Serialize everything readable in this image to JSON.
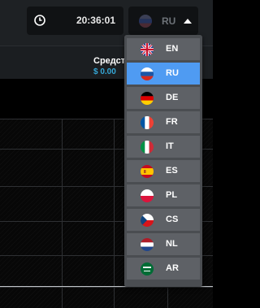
{
  "header": {
    "time": "20:36:01",
    "current_language": "RU",
    "clock_icon": "clock-icon",
    "caret_icon": "caret-up-icon"
  },
  "account": {
    "funds_label": "Средст",
    "funds_value": "$ 0.00"
  },
  "languages": [
    {
      "code": "EN",
      "flag": "uk-flag-icon",
      "active": false
    },
    {
      "code": "RU",
      "flag": "russia-flag-icon",
      "active": true
    },
    {
      "code": "DE",
      "flag": "germany-flag-icon",
      "active": false
    },
    {
      "code": "FR",
      "flag": "france-flag-icon",
      "active": false
    },
    {
      "code": "IT",
      "flag": "italy-flag-icon",
      "active": false
    },
    {
      "code": "ES",
      "flag": "spain-flag-icon",
      "active": false
    },
    {
      "code": "PL",
      "flag": "poland-flag-icon",
      "active": false
    },
    {
      "code": "CS",
      "flag": "czech-flag-icon",
      "active": false
    },
    {
      "code": "NL",
      "flag": "netherlands-flag-icon",
      "active": false
    },
    {
      "code": "AR",
      "flag": "saudi-flag-icon",
      "active": false
    }
  ],
  "colors": {
    "active_item": "#4f9bf2",
    "item": "#5e6166",
    "funds_value": "#35a7d6"
  }
}
